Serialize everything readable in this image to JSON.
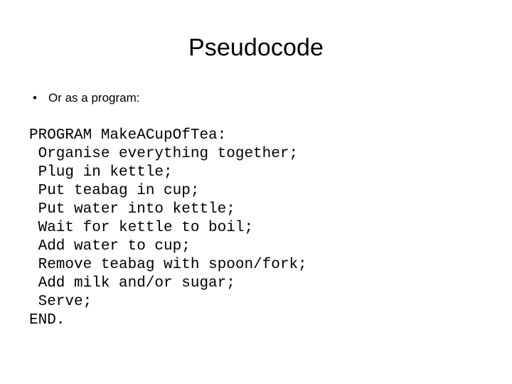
{
  "slide": {
    "title": "Pseudocode",
    "background_color": "#ffffff",
    "text_color": "#000000"
  },
  "bullets": {
    "marker": "•",
    "items": [
      {
        "label": "Or as a program:"
      }
    ]
  },
  "code": {
    "lines": [
      "PROGRAM MakeACupOfTea:",
      " Organise everything together;",
      " Plug in kettle;",
      " Put teabag in cup;",
      " Put water into kettle;",
      " Wait for kettle to boil;",
      " Add water to cup;",
      " Remove teabag with spoon/fork;",
      " Add milk and/or sugar;",
      " Serve;",
      "END."
    ]
  }
}
